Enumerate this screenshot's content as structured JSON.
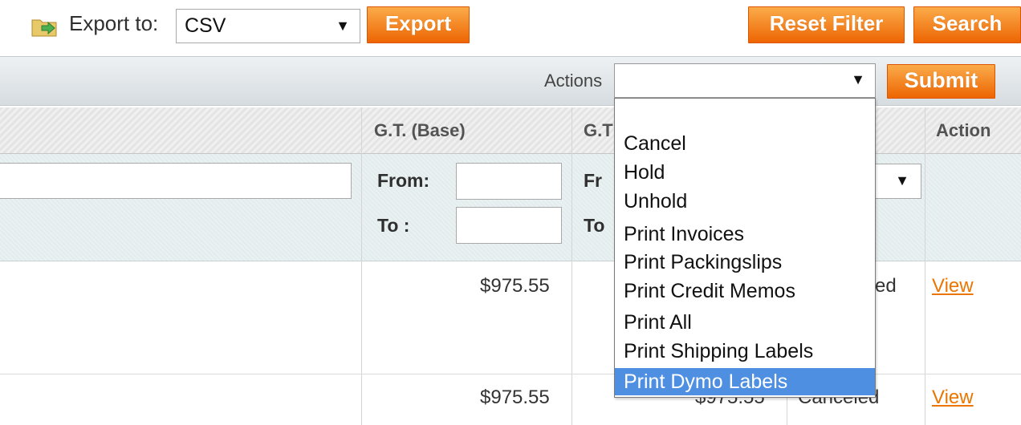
{
  "toolbar": {
    "export_icon": "export-icon",
    "export_label": "Export to:",
    "export_format": "CSV",
    "export_button": "Export",
    "reset_filter_button": "Reset Filter",
    "search_button": "Search"
  },
  "massaction": {
    "label": "Actions",
    "selected": "",
    "submit_button": "Submit",
    "options": [
      "",
      "Cancel",
      "Hold",
      "Unhold",
      "Print Invoices",
      "Print Packingslips",
      "Print Credit Memos",
      "Print All",
      "Print Shipping Labels",
      "Print Dymo Labels"
    ],
    "highlighted": "Print Dymo Labels"
  },
  "grid": {
    "headers": {
      "gt_base": "G.T. (Base)",
      "gt_purchased_partial": "G.T",
      "action": "Action"
    },
    "filters": {
      "from_label": "From:",
      "to_label": "To :",
      "from_label_partial": "Fr",
      "to_label_partial": "To"
    },
    "rows": [
      {
        "gt_base": "$975.55",
        "status_partial": "ed",
        "action": "View"
      },
      {
        "gt_base": "$975.55",
        "gt_purchased_partial": "$975.55",
        "status": "Canceled",
        "action": "View"
      }
    ]
  },
  "colors": {
    "button_orange": "#f18200",
    "link_orange": "#ea7601",
    "highlight_blue": "#4e8fe2"
  }
}
